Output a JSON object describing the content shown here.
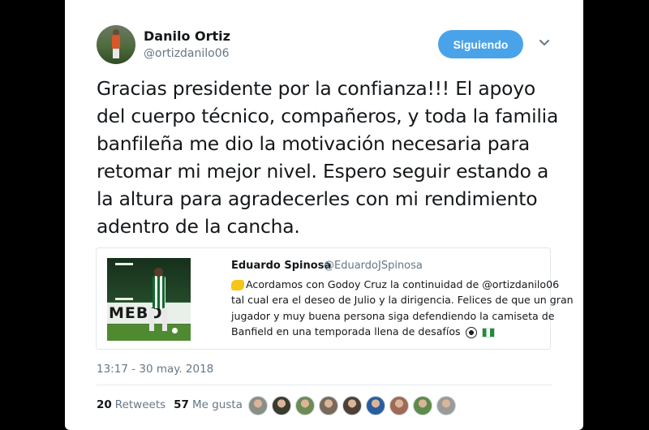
{
  "tweet": {
    "author_name": "Danilo Ortiz",
    "author_handle": "@ortizdanilo06",
    "follow_label": "Siguiendo",
    "text": "Gracias presidente por la confianza!!! El apoyo del cuerpo técnico, compañeros, y toda la familia banfileña me dio la motivación necesaria para retomar mi mejor nivel. Espero seguir estando a la altura para agradecerles con mi rendimiento adentro de la cancha.",
    "timestamp": "13:17 - 30 may. 2018"
  },
  "quote": {
    "author_name": "Eduardo Spinosa",
    "author_handle": "@EduardoJSpinosa",
    "banner_text": "MEBO",
    "lines": [
      "Acordamos con Godoy Cruz la continuidad de @ortizdanilo06",
      "tal cual era el deseo de Julio y la dirigencia. Felices de que un gran",
      "jugador y muy buena persona siga defendiendo la camiseta de",
      "Banfield en una temporada llena de desafíos"
    ]
  },
  "stats": {
    "retweets_count": "20",
    "retweets_label": "Retweets",
    "likes_count": "57",
    "likes_label": "Me gusta"
  },
  "likers": [
    {
      "color": "#8a8f86"
    },
    {
      "color": "#3b3b2e"
    },
    {
      "color": "#6d8c54"
    },
    {
      "color": "#7a6a5a"
    },
    {
      "color": "#4d4036"
    },
    {
      "color": "#2b5c9e"
    },
    {
      "color": "#a06a55"
    },
    {
      "color": "#5e8a4a"
    },
    {
      "color": "#9a9a9a"
    }
  ],
  "icons": {
    "chevron": "chevron-down-icon",
    "hand": "pointing-hand-icon",
    "ball": "soccer-ball-icon",
    "flag": "nigeria-flag-icon"
  }
}
